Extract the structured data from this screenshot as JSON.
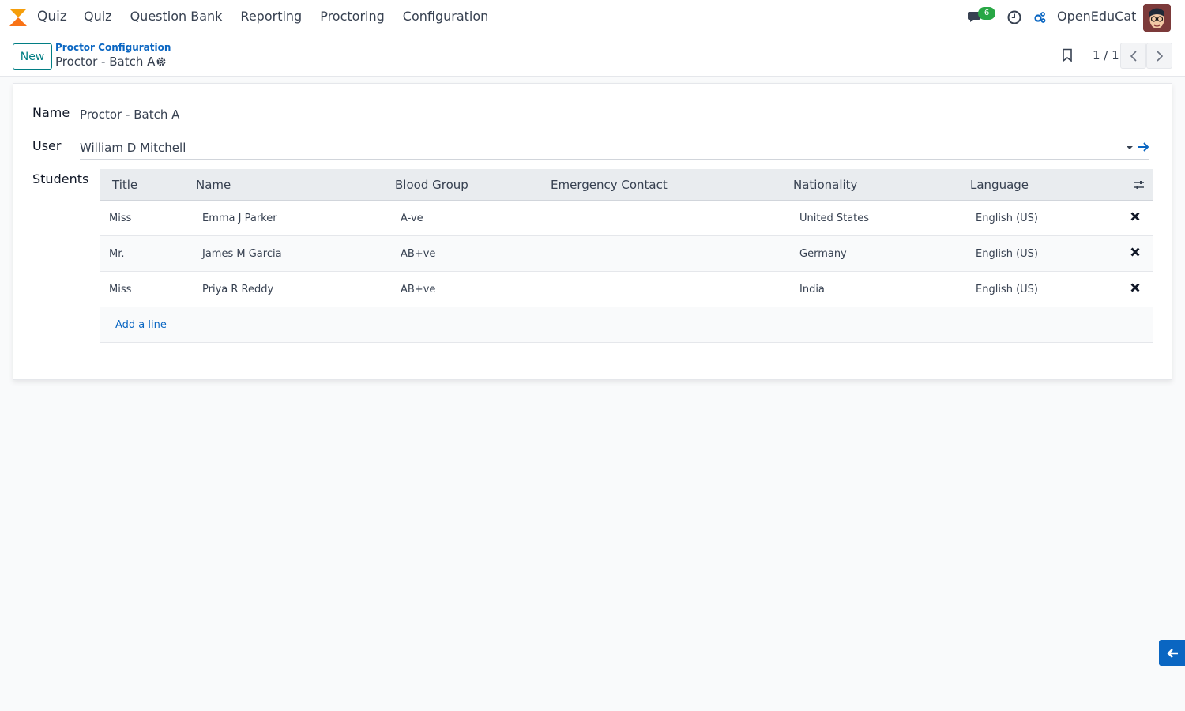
{
  "navbar": {
    "app_name": "Quiz",
    "menu": [
      "Quiz",
      "Question Bank",
      "Reporting",
      "Proctoring",
      "Configuration"
    ],
    "chat_badge": "6",
    "company": "OpenEduCat"
  },
  "control_panel": {
    "new_label": "New",
    "breadcrumb_parent": "Proctor Configuration",
    "breadcrumb_current": "Proctor - Batch A",
    "pager": "1 / 1"
  },
  "form": {
    "name_label": "Name",
    "name_value": "Proctor - Batch A",
    "user_label": "User",
    "user_value": "William D Mitchell",
    "students_label": "Students"
  },
  "students_table": {
    "columns": [
      "Title",
      "Name",
      "Blood Group",
      "Emergency Contact",
      "Nationality",
      "Language"
    ],
    "rows": [
      {
        "title": "Miss",
        "name": "Emma J Parker",
        "blood_group": "A-ve",
        "emergency_contact": "",
        "nationality": "United States",
        "language": "English (US)"
      },
      {
        "title": "Mr.",
        "name": "James M Garcia",
        "blood_group": "AB+ve",
        "emergency_contact": "",
        "nationality": "Germany",
        "language": "English (US)"
      },
      {
        "title": "Miss",
        "name": "Priya R Reddy",
        "blood_group": "AB+ve",
        "emergency_contact": "",
        "nationality": "India",
        "language": "English (US)"
      }
    ],
    "add_line": "Add a line"
  },
  "colors": {
    "accent": "#0a66c2",
    "primary_outline": "#017e84",
    "badge": "#28a745",
    "logo": "#f59e0b"
  },
  "icons": [
    "quiz-logo",
    "chat-icon",
    "clock-icon",
    "debug-icon",
    "avatar",
    "gear-icon",
    "bookmark-icon",
    "chevron-left-icon",
    "chevron-right-icon",
    "dropdown-caret-icon",
    "external-link-arrow-icon",
    "column-settings-icon",
    "delete-icon",
    "arrow-left-icon"
  ]
}
